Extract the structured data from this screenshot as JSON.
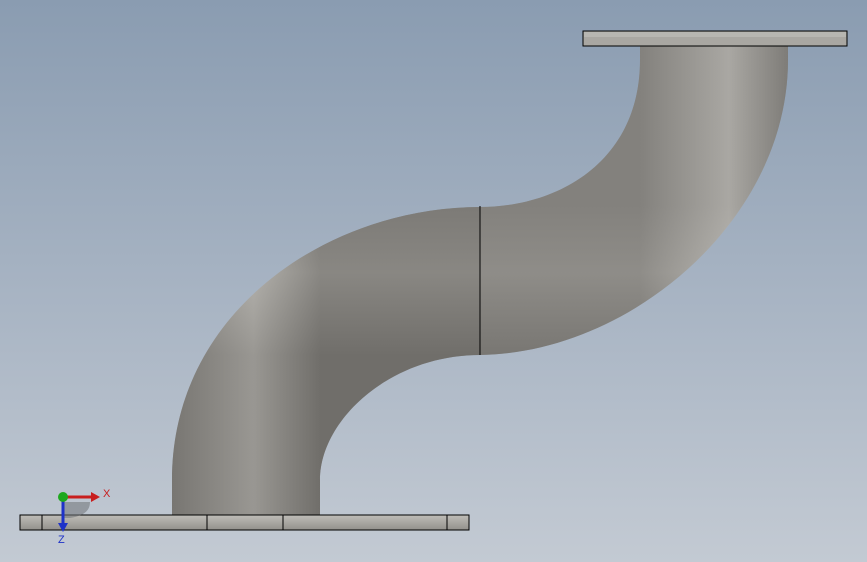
{
  "viewport": {
    "background_top": "#8a9cb1",
    "background_bottom": "#c3cad3"
  },
  "model": {
    "pipe_color": "#9a9893",
    "flange_color": "#aaa8a3",
    "edge_color": "#000000"
  },
  "triad": {
    "x_label": "X",
    "z_label": "Z",
    "x_color": "#c81e1e",
    "y_color": "#1ea81e",
    "z_color": "#1e32c8"
  }
}
